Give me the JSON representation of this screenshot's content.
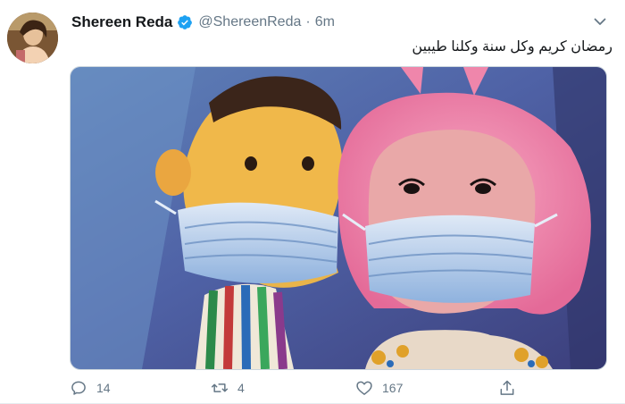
{
  "tweet": {
    "author_name": "Shereen Reda",
    "handle": "@ShereenReda",
    "separator": "·",
    "time": "6m",
    "text": "رمضان كريم وكل سنة وكلنا طيبين",
    "actions": {
      "replies": "14",
      "retweets": "4",
      "likes": "167"
    }
  },
  "icons": {
    "verified": "verified-badge-icon",
    "more": "chevron-down-icon",
    "reply": "reply-icon",
    "retweet": "retweet-icon",
    "like": "heart-icon",
    "share": "share-icon"
  },
  "colors": {
    "verified_blue": "#1da1f2",
    "secondary_text": "#657786"
  }
}
